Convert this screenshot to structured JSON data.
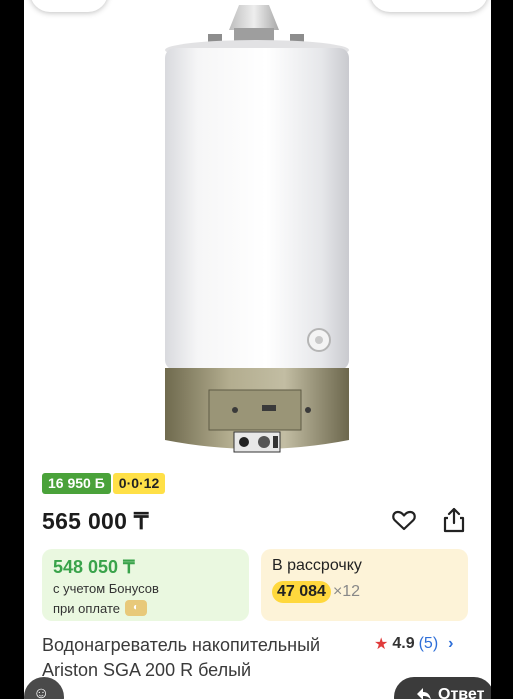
{
  "product": {
    "image_alt": "Ariston SGA 200 R",
    "bonus_badge": "16 950 Б",
    "installment_badge": "0·0·12",
    "price": "565 000 ₸",
    "bonus_card": {
      "price": "548 050 ₸",
      "line1": "с учетом Бонусов",
      "line2": "при оплате"
    },
    "installment_card": {
      "title": "В рассрочку",
      "amount": "47 084",
      "multiplier": "×12"
    },
    "title_line1": "Водонагреватель накопительный",
    "title_line2": "Ariston SGA 200 R белый",
    "rating": {
      "value": "4.9",
      "count": "(5)"
    }
  },
  "reply_button": {
    "label": "Ответ"
  },
  "icons": {
    "favorite": "heart-icon",
    "share": "share-icon",
    "rating_star": "star-icon",
    "reply": "reply-arrow-icon",
    "chat": "chat-icon"
  },
  "colors": {
    "bonus_green": "#39a34a",
    "badge_yellow": "#ffe047",
    "star_red": "#e03b3b",
    "link_blue": "#2f6fd8"
  }
}
